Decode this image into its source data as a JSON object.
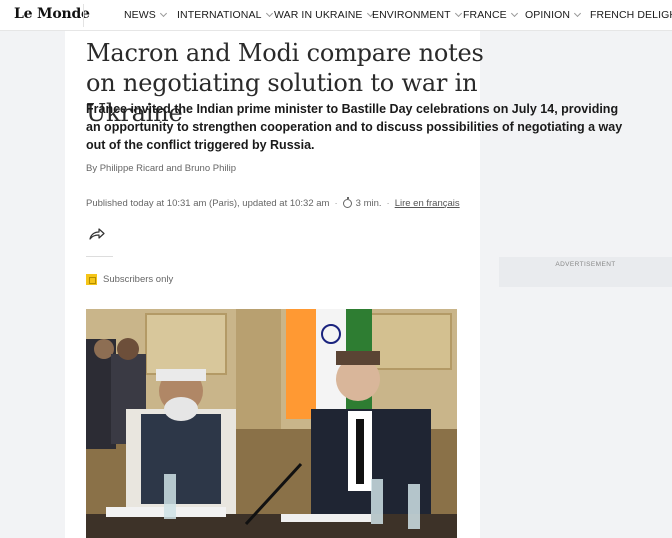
{
  "site": {
    "logo": "Le Monde"
  },
  "nav": {
    "items": [
      {
        "label": "NEWS",
        "dropdown": true
      },
      {
        "label": "INTERNATIONAL",
        "dropdown": true
      },
      {
        "label": "WAR IN UKRAINE",
        "dropdown": true
      },
      {
        "label": "ENVIRONMENT",
        "dropdown": true
      },
      {
        "label": "FRANCE",
        "dropdown": true
      },
      {
        "label": "OPINION",
        "dropdown": true
      },
      {
        "label": "FRENCH DELIGHTS",
        "dropdown": false
      }
    ]
  },
  "article": {
    "headline": "Macron and Modi compare notes on negotiating solution to war in Ukraine",
    "standfirst": "France invited the Indian prime minister to Bastille Day celebrations on July 14, providing an opportunity to strengthen cooperation and to discuss possibilities of negotiating a way out of the conflict triggered by Russia.",
    "byline": "By Philippe Ricard and Bruno Philip",
    "published": "Published today at 10:31 am (Paris), updated at 10:32 am",
    "separator": "·",
    "read_time": "3 min.",
    "french_link": "Lire en français",
    "subscribers": "Subscribers only"
  },
  "ad": {
    "label": "ADVERTISEMENT"
  },
  "colors": {
    "badge": "#f5c518",
    "page_bg": "#f2f3f5"
  },
  "icons": {
    "share": "share-arrow-icon",
    "timer": "stopwatch-icon",
    "subscriber": "subscriber-badge-icon"
  }
}
